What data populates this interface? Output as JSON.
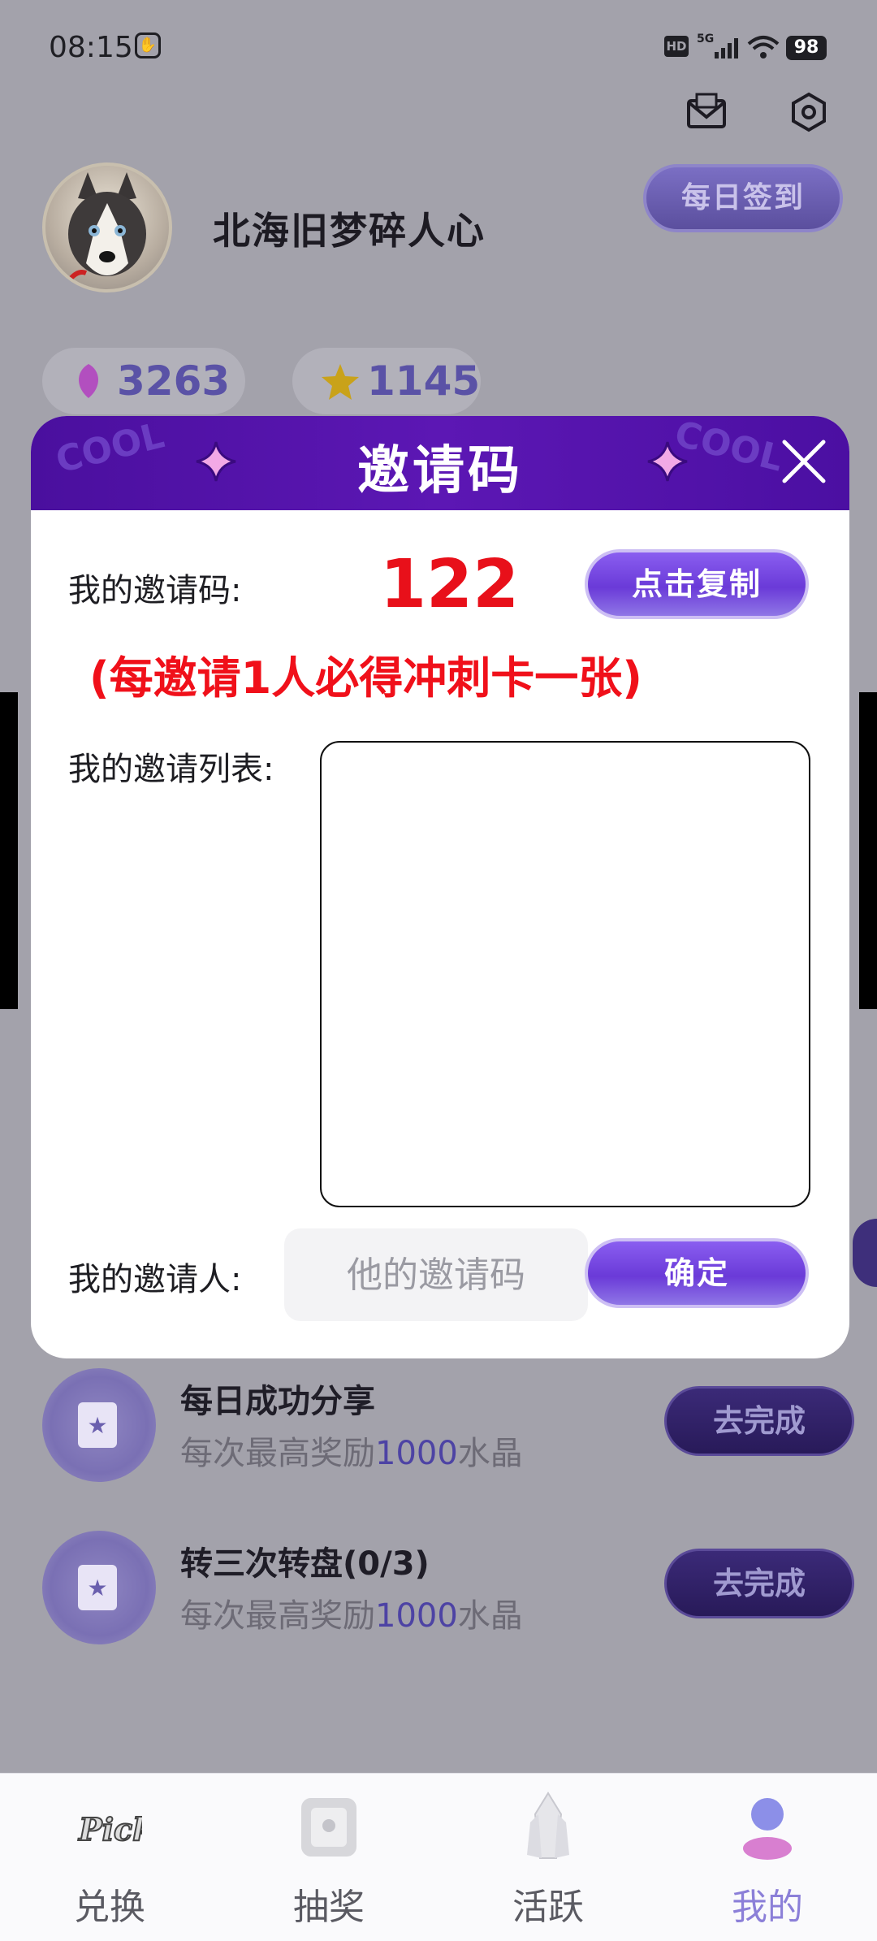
{
  "status_bar": {
    "time": "08:15",
    "hd": "HD",
    "network": "5G",
    "battery": "98"
  },
  "profile": {
    "name": "北海旧梦碎人心",
    "checkin_label": "每日签到"
  },
  "stats": {
    "crystals": "3263",
    "stars": "1145"
  },
  "tasks": [
    {
      "title": "每日成功分享",
      "sub_prefix": "每次最高奖励",
      "sub_amount": "1000",
      "sub_suffix": "水晶",
      "button": "去完成"
    },
    {
      "title": "转三次转盘(0/3)",
      "sub_prefix": "每次最高奖励",
      "sub_amount": "1000",
      "sub_suffix": "水晶",
      "button": "去完成"
    }
  ],
  "tabbar": {
    "items": [
      {
        "label": "兑换",
        "icon": "pick-logo-icon"
      },
      {
        "label": "抽奖",
        "icon": "lottery-card-icon"
      },
      {
        "label": "活跃",
        "icon": "crystal-icon"
      },
      {
        "label": "我的",
        "icon": "profile-icon",
        "active": true
      }
    ]
  },
  "modal": {
    "title": "邀请码",
    "my_code_label": "我的邀请码:",
    "my_code": "122",
    "copy_button": "点击复制",
    "promo": "(每邀请1人必得冲刺卡一张)",
    "invite_list_label": "我的邀请列表:",
    "inviter_label": "我的邀请人:",
    "inviter_placeholder": "他的邀请码",
    "inviter_value": "",
    "confirm_button": "确定"
  },
  "colors": {
    "header_purple": "#4a0f9e",
    "accent_red": "#e8101a",
    "accent_purple": "#7a4ce6"
  }
}
